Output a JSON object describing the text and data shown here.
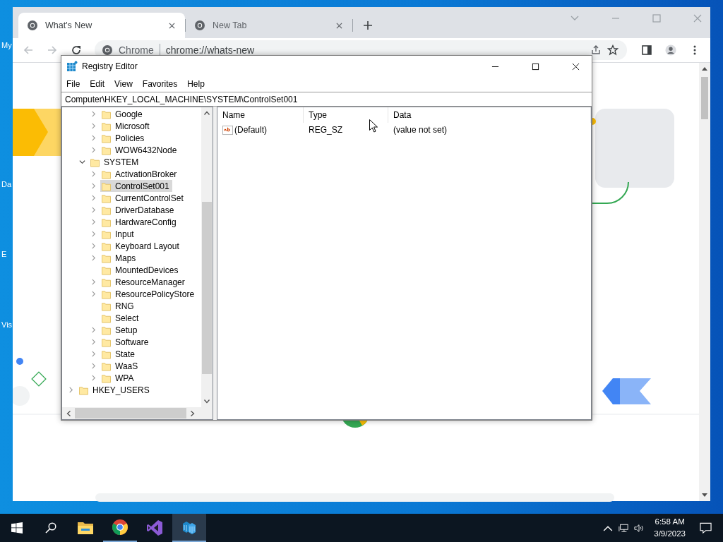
{
  "desktop": {
    "icon_labels": [
      "My",
      "Da",
      "E",
      "Vis"
    ]
  },
  "browser": {
    "tabs": [
      {
        "title": "What's New",
        "selected": true
      },
      {
        "title": "New Tab",
        "selected": false
      }
    ],
    "omnibox": {
      "chip": "Chrome",
      "url": "chrome://whats-new"
    }
  },
  "registry_editor": {
    "title": "Registry Editor",
    "menu": [
      "File",
      "Edit",
      "View",
      "Favorites",
      "Help"
    ],
    "address": "Computer\\HKEY_LOCAL_MACHINE\\SYSTEM\\ControlSet001",
    "tree": [
      {
        "children": [
          {
            "children": [
              {
                "label": "Google",
                "expandable": true,
                "selected": false
              },
              {
                "label": "Microsoft",
                "expandable": true,
                "selected": false
              },
              {
                "label": "Policies",
                "expandable": true,
                "selected": false
              },
              {
                "label": "WOW6432Node",
                "expandable": true,
                "selected": false
              }
            ]
          },
          {
            "label": "SYSTEM",
            "expandable": true,
            "expanded": true,
            "selected": false,
            "children": [
              {
                "label": "ActivationBroker",
                "expandable": true,
                "selected": false
              },
              {
                "label": "ControlSet001",
                "expandable": true,
                "selected": true
              },
              {
                "label": "CurrentControlSet",
                "expandable": true,
                "selected": false
              },
              {
                "label": "DriverDatabase",
                "expandable": true,
                "selected": false
              },
              {
                "label": "HardwareConfig",
                "expandable": true,
                "selected": false
              },
              {
                "label": "Input",
                "expandable": true,
                "selected": false
              },
              {
                "label": "Keyboard Layout",
                "expandable": true,
                "selected": false
              },
              {
                "label": "Maps",
                "expandable": true,
                "selected": false
              },
              {
                "label": "MountedDevices",
                "expandable": false,
                "selected": false
              },
              {
                "label": "ResourceManager",
                "expandable": true,
                "selected": false
              },
              {
                "label": "ResourcePolicyStore",
                "expandable": true,
                "selected": false
              },
              {
                "label": "RNG",
                "expandable": false,
                "selected": false
              },
              {
                "label": "Select",
                "expandable": false,
                "selected": false
              },
              {
                "label": "Setup",
                "expandable": true,
                "selected": false
              },
              {
                "label": "Software",
                "expandable": true,
                "selected": false
              },
              {
                "label": "State",
                "expandable": true,
                "selected": false
              },
              {
                "label": "WaaS",
                "expandable": true,
                "selected": false
              },
              {
                "label": "WPA",
                "expandable": true,
                "selected": false
              }
            ]
          }
        ]
      },
      {
        "label": "HKEY_USERS",
        "expandable": true,
        "selected": false
      }
    ],
    "columns": [
      "Name",
      "Type",
      "Data"
    ],
    "values": [
      {
        "kind": "string",
        "name": "(Default)",
        "type": "REG_SZ",
        "data": "(value not set)"
      }
    ]
  },
  "taskbar": {
    "apps": [
      {
        "kind": "explorer",
        "running": false,
        "active": false
      },
      {
        "kind": "chrome",
        "running": true,
        "active": false
      },
      {
        "kind": "visual-studio",
        "running": false,
        "active": false
      },
      {
        "kind": "registry",
        "running": true,
        "active": true
      }
    ],
    "clock": {
      "time": "6:58 AM",
      "date": "3/9/2023"
    }
  }
}
